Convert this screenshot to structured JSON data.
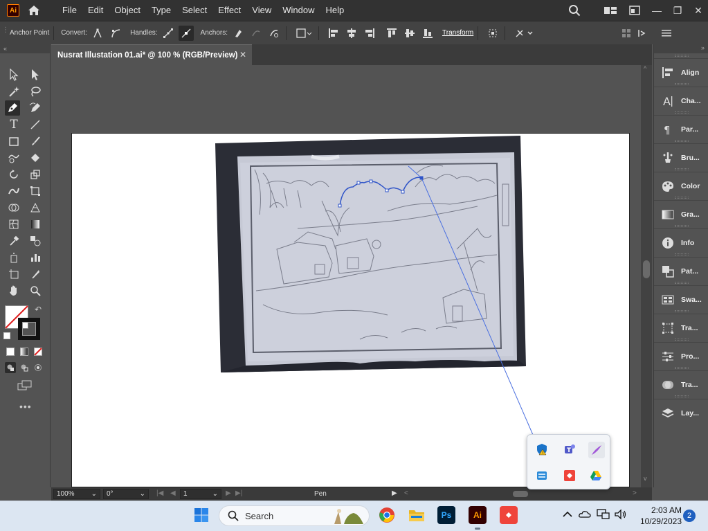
{
  "app": {
    "logo": "Ai"
  },
  "menu": [
    "File",
    "Edit",
    "Object",
    "Type",
    "Select",
    "Effect",
    "View",
    "Window",
    "Help"
  ],
  "controlbar": {
    "anchor_point": "Anchor Point",
    "convert": "Convert:",
    "handles": "Handles:",
    "anchors": "Anchors:",
    "transform": "Transform"
  },
  "document": {
    "tab_title": "Nusrat Illustation 01.ai* @ 100 % (RGB/Preview)",
    "close": "✕"
  },
  "statusbar": {
    "zoom": "100%",
    "rotation": "0°",
    "artboard": "1",
    "tool": "Pen"
  },
  "panels": [
    {
      "label": "Align",
      "icon": "align-icon"
    },
    {
      "label": "Cha...",
      "icon": "character-icon"
    },
    {
      "label": "Par...",
      "icon": "paragraph-icon"
    },
    {
      "label": "Bru...",
      "icon": "brushes-icon"
    },
    {
      "label": "Color",
      "icon": "color-icon"
    },
    {
      "label": "Gra...",
      "icon": "gradient-icon"
    },
    {
      "label": "Info",
      "icon": "info-icon"
    },
    {
      "label": "Pat...",
      "icon": "pathfinder-icon"
    },
    {
      "label": "Swa...",
      "icon": "swatches-icon"
    },
    {
      "label": "Tra...",
      "icon": "transform-icon"
    },
    {
      "label": "Pro...",
      "icon": "properties-icon"
    },
    {
      "label": "Tra...",
      "icon": "transparency-icon"
    },
    {
      "label": "Lay...",
      "icon": "layers-icon"
    }
  ],
  "taskbar": {
    "search_label": "Search",
    "time": "2:03 AM",
    "date": "10/29/2023",
    "notifications": "2",
    "pinned": [
      "windows-start-icon",
      "chrome-icon",
      "file-explorer-icon",
      "photoshop-icon",
      "illustrator-icon",
      "anydesk-icon"
    ],
    "ps_label": "Ps",
    "ai_label": "Ai"
  },
  "tray_popup": [
    "windows-security-icon",
    "teams-icon",
    "pen-app-icon",
    "network-drive-icon",
    "anydesk-tray-icon",
    "google-drive-icon"
  ]
}
